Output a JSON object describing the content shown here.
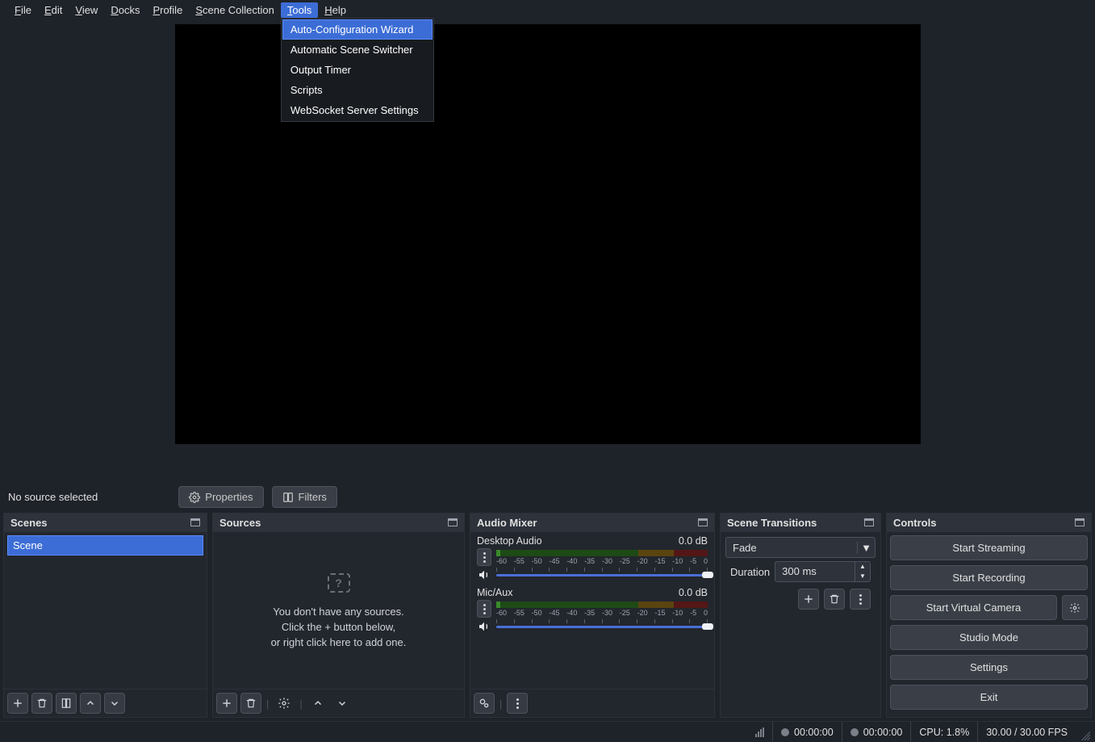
{
  "menubar": {
    "items": [
      {
        "label": "File",
        "accel": "F"
      },
      {
        "label": "Edit",
        "accel": "E"
      },
      {
        "label": "View",
        "accel": "V"
      },
      {
        "label": "Docks",
        "accel": "D"
      },
      {
        "label": "Profile",
        "accel": "P"
      },
      {
        "label": "Scene Collection",
        "accel": "S"
      },
      {
        "label": "Tools",
        "accel": "T"
      },
      {
        "label": "Help",
        "accel": "H"
      }
    ],
    "open_index": 6,
    "dropdown": {
      "items": [
        "Auto-Configuration Wizard",
        "Automatic Scene Switcher",
        "Output Timer",
        "Scripts",
        "WebSocket Server Settings"
      ],
      "highlight_index": 0
    }
  },
  "source_bar": {
    "status": "No source selected",
    "properties_label": "Properties",
    "filters_label": "Filters"
  },
  "docks": {
    "scenes": {
      "title": "Scenes",
      "items": [
        "Scene"
      ]
    },
    "sources": {
      "title": "Sources",
      "empty_line1": "You don't have any sources.",
      "empty_line2": "Click the + button below,",
      "empty_line3": "or right click here to add one."
    },
    "mixer": {
      "title": "Audio Mixer",
      "tracks": [
        {
          "name": "Desktop Audio",
          "db": "0.0 dB"
        },
        {
          "name": "Mic/Aux",
          "db": "0.0 dB"
        }
      ],
      "tick_labels": [
        "-60",
        "-55",
        "-50",
        "-45",
        "-40",
        "-35",
        "-30",
        "-25",
        "-20",
        "-15",
        "-10",
        "-5",
        "0"
      ]
    },
    "transitions": {
      "title": "Scene Transitions",
      "selected": "Fade",
      "duration_label": "Duration",
      "duration_value": "300 ms"
    },
    "controls": {
      "title": "Controls",
      "buttons": {
        "start_streaming": "Start Streaming",
        "start_recording": "Start Recording",
        "start_virtual_camera": "Start Virtual Camera",
        "studio_mode": "Studio Mode",
        "settings": "Settings",
        "exit": "Exit"
      }
    }
  },
  "statusbar": {
    "live_time": "00:00:00",
    "rec_time": "00:00:00",
    "cpu": "CPU: 1.8%",
    "fps": "30.00 / 30.00 FPS"
  }
}
